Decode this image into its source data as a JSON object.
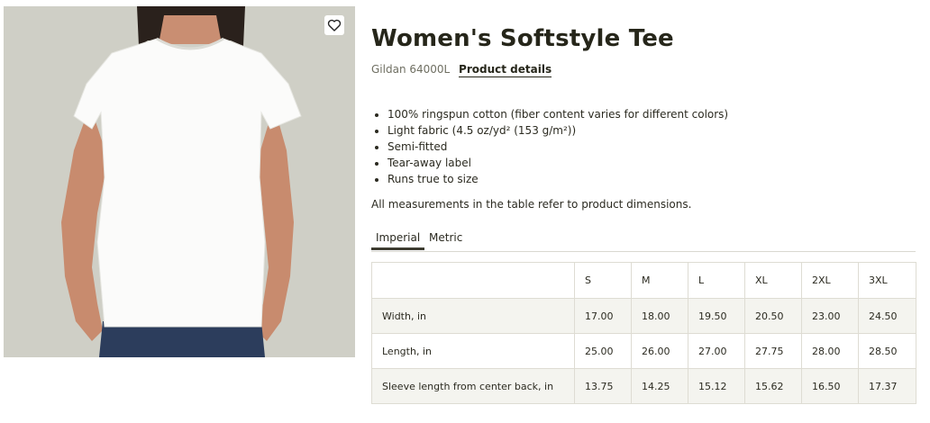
{
  "product": {
    "title": "Women's Softstyle Tee",
    "model": "Gildan 64000L",
    "details_link": "Product details",
    "image_icon": "wishlist-heart-icon"
  },
  "features": [
    "100% ringspun cotton (fiber content varies for different colors)",
    "Light fabric (4.5 oz/yd² (153 g/m²))",
    "Semi-fitted",
    "Tear-away label",
    "Runs true to size"
  ],
  "note": "All measurements in the table refer to product dimensions.",
  "tabs": [
    {
      "label": "Imperial",
      "active": true
    },
    {
      "label": "Metric",
      "active": false
    }
  ],
  "size_table": {
    "sizes": [
      "S",
      "M",
      "L",
      "XL",
      "2XL",
      "3XL"
    ],
    "rows": [
      {
        "label": "Width, in",
        "values": [
          "17.00",
          "18.00",
          "19.50",
          "20.50",
          "23.00",
          "24.50"
        ]
      },
      {
        "label": "Length, in",
        "values": [
          "25.00",
          "26.00",
          "27.00",
          "27.75",
          "28.00",
          "28.50"
        ]
      },
      {
        "label": "Sleeve length from center back, in",
        "values": [
          "13.75",
          "14.25",
          "15.12",
          "15.62",
          "16.50",
          "17.37"
        ]
      }
    ]
  },
  "colors": {
    "background_photo": "#cfcfc6",
    "table_stripe": "#f4f4ef",
    "text_dark": "#26261a",
    "tab_underline": "#3d3c30"
  }
}
